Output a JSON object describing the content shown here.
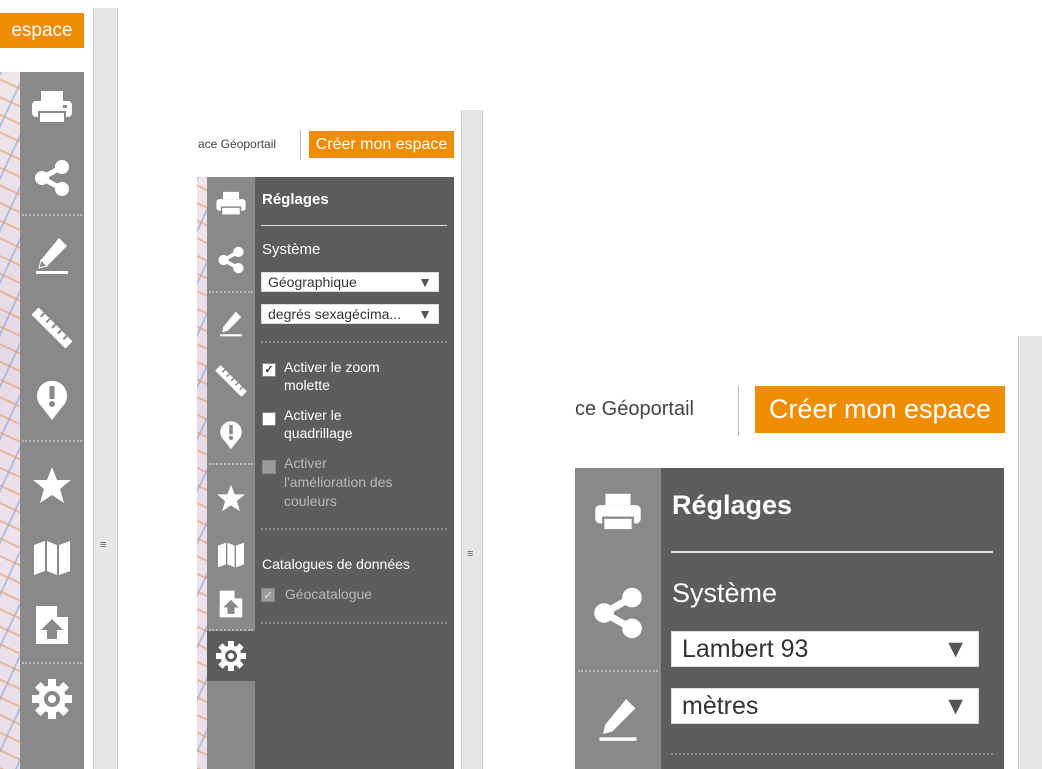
{
  "left_view": {
    "header": {
      "create_button": "espace"
    },
    "tools": [
      {
        "icon": "printer-icon"
      },
      {
        "icon": "share-icon"
      },
      {
        "icon": "pencil-icon"
      },
      {
        "icon": "ruler-icon"
      },
      {
        "icon": "alert-icon"
      },
      {
        "icon": "star-icon"
      },
      {
        "icon": "map-icon"
      },
      {
        "icon": "upload-file-icon"
      },
      {
        "icon": "gear-icon"
      }
    ]
  },
  "middle_view": {
    "header": {
      "link_text": "ace Géoportail",
      "create_button": "Créer mon espace"
    },
    "panel": {
      "title": "Réglages",
      "system_label": "Système",
      "system_select": "Géographique",
      "unit_select": "degrés sexagécima...",
      "options": [
        {
          "label": "Activer le zoom molette",
          "checked": true,
          "disabled": false
        },
        {
          "label": "Activer le quadrillage",
          "checked": false,
          "disabled": false
        },
        {
          "label": "Activer l'amélioration des couleurs",
          "checked": false,
          "disabled": true
        }
      ],
      "catalogues_label": "Catalogues de données",
      "catalogue_option": {
        "label": "Géocatalogue",
        "checked": true,
        "disabled": true
      }
    }
  },
  "right_view": {
    "header": {
      "link_text": "ce Géoportail",
      "create_button": "Créer mon espace"
    },
    "panel": {
      "title": "Réglages",
      "system_label": "Système",
      "system_select": "Lambert 93",
      "unit_select": "mètres"
    }
  },
  "colors": {
    "accent": "#f08c00",
    "toolbar": "#898989",
    "panel": "#5d5d5d"
  }
}
